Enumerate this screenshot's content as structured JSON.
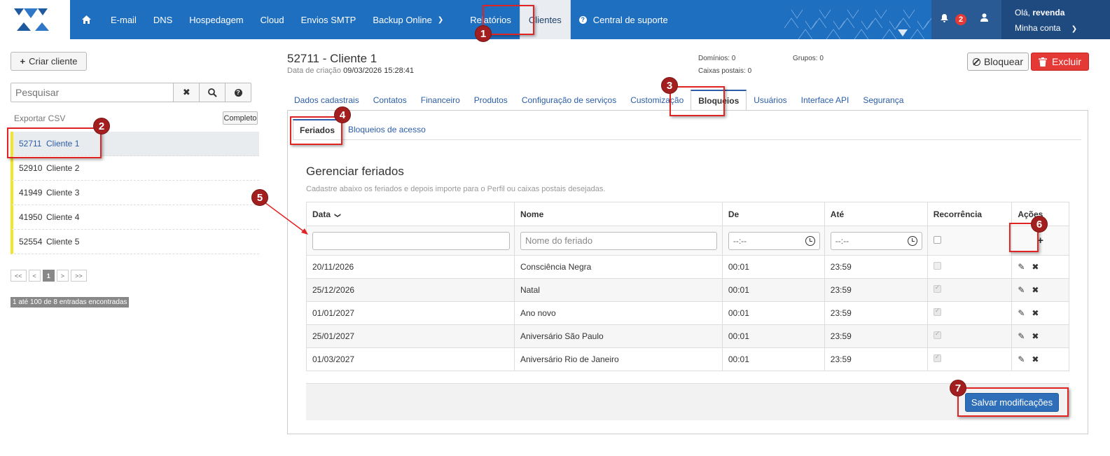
{
  "nav": {
    "items": [
      "E-mail",
      "DNS",
      "Hospedagem",
      "Cloud",
      "Envios SMTP",
      "Backup Online",
      "Relatórios",
      "Clientes",
      "Central de suporte"
    ],
    "notification_count": "2",
    "greeting_prefix": "Olá,",
    "greeting_user": "revenda",
    "account_label": "Minha conta"
  },
  "sidebar": {
    "create_label": "Criar cliente",
    "search_placeholder": "Pesquisar",
    "export_label": "Exportar CSV",
    "complete_label": "Completo",
    "clients": [
      {
        "id": "52711",
        "name": "Cliente 1"
      },
      {
        "id": "52910",
        "name": "Cliente 2"
      },
      {
        "id": "41949",
        "name": "Cliente 3"
      },
      {
        "id": "41950",
        "name": "Cliente 4"
      },
      {
        "id": "52554",
        "name": "Cliente 5"
      }
    ],
    "pager": [
      "<<",
      "<",
      "1",
      ">",
      ">>"
    ],
    "entries_text": "1 até 100 de 8 entradas encontradas"
  },
  "header": {
    "title": "52711 - Cliente 1",
    "created_label": "Data de criação",
    "created_value": "09/03/2026 15:28:41",
    "domains": "Domínios: 0",
    "mailboxes": "Caixas postais: 0",
    "groups": "Grupos: 0",
    "block_label": "Bloquear",
    "delete_label": "Excluir"
  },
  "tabs": [
    "Dados cadastrais",
    "Contatos",
    "Financeiro",
    "Produtos",
    "Configuração de serviços",
    "Customização",
    "Bloqueios",
    "Usuários",
    "Interface API",
    "Segurança"
  ],
  "subtabs": [
    "Feriados",
    "Bloqueios de acesso"
  ],
  "holidays": {
    "title": "Gerenciar feriados",
    "description": "Cadastre abaixo os feriados e depois importe para o Perfil ou caixas postais desejadas.",
    "columns": [
      "Data",
      "Nome",
      "De",
      "Até",
      "Recorrência",
      "Ações"
    ],
    "name_placeholder": "Nome do feriado",
    "time_placeholder": "--:--",
    "rows": [
      {
        "date": "20/11/2026",
        "name": "Consciência Negra",
        "from": "00:01",
        "to": "23:59",
        "recurring": false
      },
      {
        "date": "25/12/2026",
        "name": "Natal",
        "from": "00:01",
        "to": "23:59",
        "recurring": true
      },
      {
        "date": "01/01/2027",
        "name": "Ano novo",
        "from": "00:01",
        "to": "23:59",
        "recurring": true
      },
      {
        "date": "25/01/2027",
        "name": "Aniversário São Paulo",
        "from": "00:01",
        "to": "23:59",
        "recurring": true
      },
      {
        "date": "01/03/2027",
        "name": "Aniversário Rio de Janeiro",
        "from": "00:01",
        "to": "23:59",
        "recurring": true
      }
    ],
    "save_label": "Salvar modificações"
  },
  "markers": [
    "1",
    "2",
    "3",
    "4",
    "5",
    "6",
    "7"
  ]
}
